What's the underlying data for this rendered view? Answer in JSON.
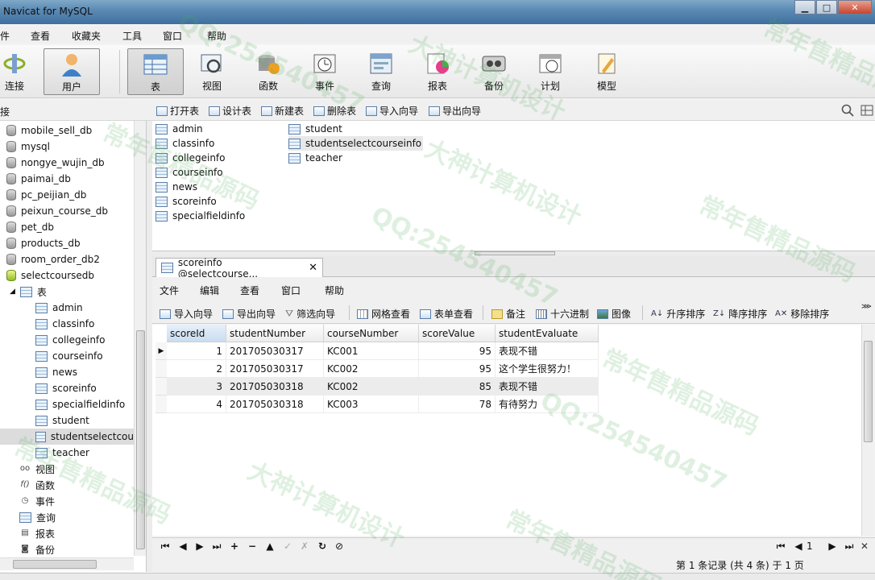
{
  "window": {
    "title": "Navicat for MySQL",
    "min": "▁",
    "max": "□",
    "close": "✕"
  },
  "menu": [
    "件",
    "查看",
    "收藏夹",
    "工具",
    "窗口",
    "帮助"
  ],
  "toolbar": {
    "connect": "连接",
    "user": "用户",
    "table": "表",
    "view": "视图",
    "function": "函数",
    "event": "事件",
    "query": "查询",
    "report": "报表",
    "backup": "备份",
    "schedule": "计划",
    "model": "模型"
  },
  "subtoolbar": {
    "left_label": "接",
    "open": "打开表",
    "design": "设计表",
    "new": "新建表",
    "delete": "删除表",
    "import": "导入向导",
    "export": "导出向导"
  },
  "tree": {
    "databases": [
      "mobile_sell_db",
      "mysql",
      "nongye_wujin_db",
      "paimai_db",
      "pc_peijian_db",
      "peixun_course_db",
      "pet_db",
      "products_db",
      "room_order_db2",
      "selectcoursedb"
    ],
    "tables_group": "表",
    "tables": [
      "admin",
      "classinfo",
      "collegeinfo",
      "courseinfo",
      "news",
      "scoreinfo",
      "specialfieldinfo",
      "student",
      "studentselectcou",
      "teacher"
    ],
    "others": {
      "view": "视图",
      "function": "函数",
      "event": "事件",
      "query": "查询",
      "report": "报表",
      "backup": "备份"
    }
  },
  "objects": {
    "col1": [
      "admin",
      "classinfo",
      "collegeinfo",
      "courseinfo",
      "news",
      "scoreinfo",
      "specialfieldinfo"
    ],
    "col2": [
      "student",
      "studentselectcourseinfo",
      "teacher"
    ]
  },
  "tab": {
    "label": "scoreinfo @selectcourse...",
    "close": "✕"
  },
  "inner_menu": [
    "文件",
    "编辑",
    "查看",
    "窗口",
    "帮助"
  ],
  "inner_toolbar": {
    "import": "导入向导",
    "export": "导出向导",
    "filter": "筛选向导",
    "grid_view": "网格查看",
    "form_view": "表单查看",
    "memo": "备注",
    "hex": "十六进制",
    "image": "图像",
    "asc": "升序排序",
    "desc": "降序排序",
    "remove_sort": "移除排序"
  },
  "grid": {
    "columns": [
      "scoreId",
      "studentNumber",
      "courseNumber",
      "scoreValue",
      "studentEvaluate"
    ],
    "rows": [
      [
        "1",
        "201705030317",
        "KC001",
        "95",
        "表现不错"
      ],
      [
        "2",
        "201705030317",
        "KC002",
        "95",
        "这个学生很努力！"
      ],
      [
        "3",
        "201705030318",
        "KC002",
        "85",
        "表现不错"
      ],
      [
        "4",
        "201705030318",
        "KC003",
        "78",
        "有待努力"
      ]
    ]
  },
  "navigator": {
    "page": "1",
    "buttons": [
      "⏮",
      "◀",
      "▶",
      "⏭",
      "+",
      "−",
      "▲",
      "✓",
      "✗",
      "↻",
      "⊘"
    ]
  },
  "status": {
    "record": "第 1 条记录 (共 4 条) 于 1 页"
  },
  "watermarks": [
    "QQ:254540457",
    "大神计算机设计",
    "常年售精品源码"
  ]
}
